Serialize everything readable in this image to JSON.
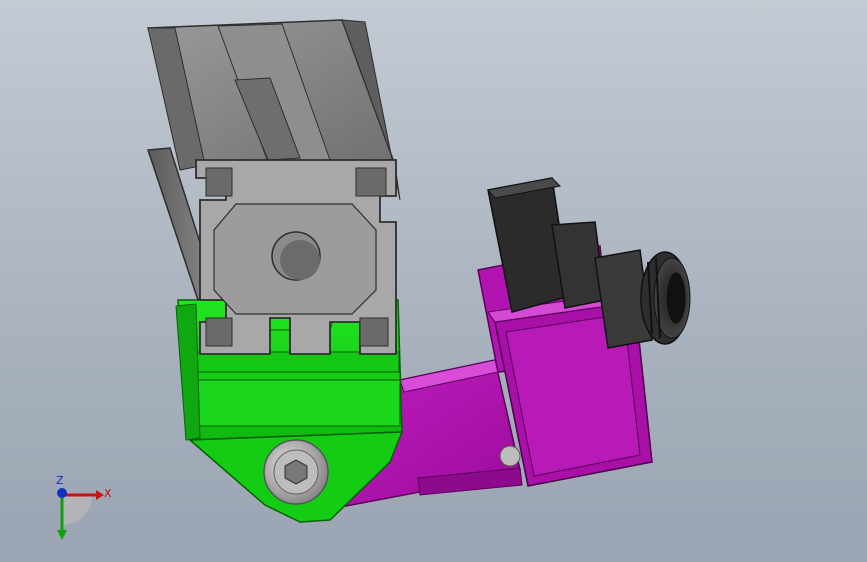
{
  "viewport": {
    "background_top": "#c3cad3",
    "background_bottom": "#9aa4b2"
  },
  "parts": {
    "extrusion": {
      "name": "aluminum-extrusion-profile",
      "color": "#7b7b7b"
    },
    "clamp": {
      "name": "extrusion-clamp",
      "color": "#12d412"
    },
    "bracket": {
      "name": "camera-bracket",
      "color": "#b012b0"
    },
    "camera": {
      "name": "camera-module",
      "color": "#2a2a2a"
    },
    "bolt": {
      "name": "socket-head-bolt",
      "color": "#c8c8c8"
    }
  },
  "triad": {
    "x_label": "X",
    "z_label": "Z",
    "x_color": "#d01010",
    "y_color": "#10a010",
    "z_color": "#1030c0"
  }
}
